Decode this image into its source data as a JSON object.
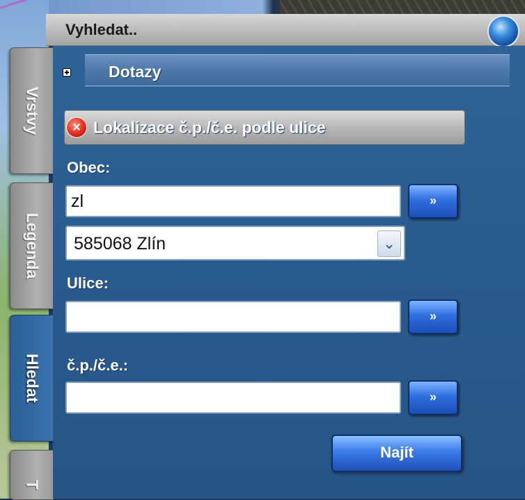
{
  "window": {
    "title": "Vyhledat..",
    "orb_icon": "globe-icon"
  },
  "side_tabs": [
    {
      "label": "Vrstvy",
      "active": false
    },
    {
      "label": "Legenda",
      "active": false
    },
    {
      "label": "Hledat",
      "active": true
    },
    {
      "label": "T",
      "active": false
    }
  ],
  "queries_section": {
    "expand_icon": "plus-icon",
    "label": "Dotazy"
  },
  "locate_section": {
    "close_icon": "close-icon",
    "label": "Lokalizace č.p./č.e. podle ulice"
  },
  "form": {
    "obec_label": "Obec:",
    "obec_value": "zl",
    "obec_select_value": "585068 Zlín",
    "ulice_label": "Ulice:",
    "ulice_value": "",
    "cp_label": "č.p./č.e.:",
    "cp_value": "",
    "go_button_label": "»",
    "search_button_label": "Najít"
  },
  "colors": {
    "panel_blue": "#2f6398",
    "button_blue": "#2f6fe0",
    "close_red": "#e22d1c"
  }
}
